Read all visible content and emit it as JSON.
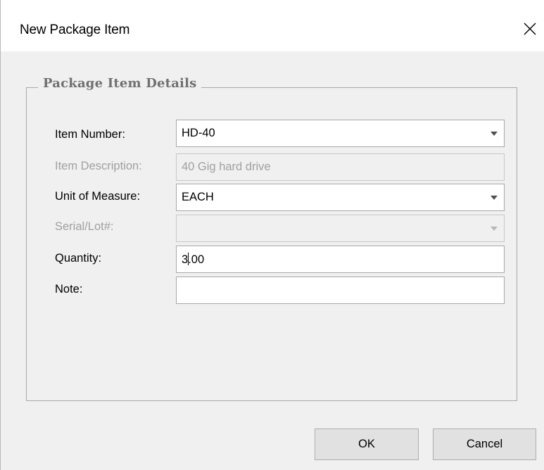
{
  "window": {
    "title": "New Package Item",
    "close_icon": "close-icon"
  },
  "group": {
    "legend": "Package Item Details"
  },
  "fields": {
    "item_number": {
      "label": "Item Number:",
      "value": "HD-40",
      "type": "dropdown",
      "enabled": true
    },
    "item_description": {
      "label": "Item Description:",
      "value": "40 Gig hard drive",
      "type": "text",
      "enabled": false
    },
    "unit_of_measure": {
      "label": "Unit of Measure:",
      "value": "EACH",
      "type": "dropdown",
      "enabled": true
    },
    "serial_lot": {
      "label": "Serial/Lot#:",
      "value": "",
      "type": "dropdown",
      "enabled": false
    },
    "quantity": {
      "label": "Quantity:",
      "value_before_caret": "3",
      "value_after_caret": ".00",
      "type": "text",
      "enabled": true
    },
    "note": {
      "label": "Note:",
      "value": "",
      "type": "text",
      "enabled": true
    }
  },
  "buttons": {
    "ok_label": "OK",
    "cancel_label": "Cancel"
  },
  "colors": {
    "background": "#f0f0f0",
    "titlebar": "#ffffff",
    "legend_text": "#707070",
    "disabled_text": "#a0a0a0",
    "button_face": "#e1e1e1"
  }
}
